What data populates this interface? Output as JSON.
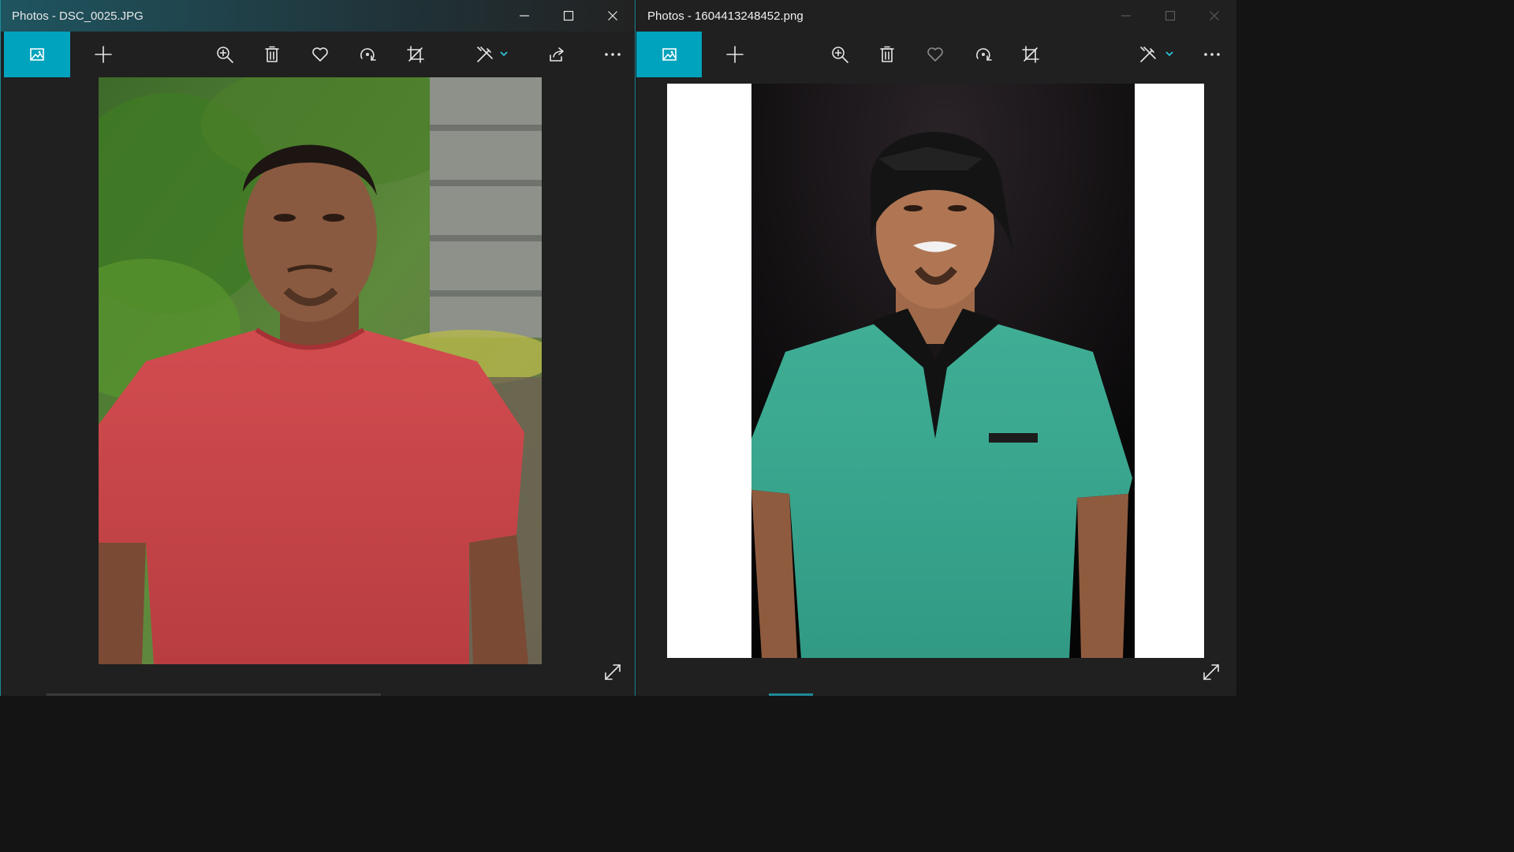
{
  "windows": [
    {
      "title": "Photos - DSC_0025.JPG",
      "toolbar": [
        "photo-view-icon",
        "add-icon",
        "zoom-in-icon",
        "delete-icon",
        "favorite-icon",
        "rotate-icon",
        "crop-icon",
        "edit-icon",
        "share-icon",
        "more-icon"
      ],
      "photo": {
        "subject": "photo",
        "shirt_color": "#c9474a",
        "background": "garden"
      }
    },
    {
      "title": "Photos - 1604413248452.png",
      "toolbar": [
        "photo-view-icon",
        "add-icon",
        "zoom-in-icon",
        "delete-icon",
        "favorite-icon",
        "rotate-icon",
        "crop-icon",
        "edit-icon",
        "more-icon"
      ],
      "photo": {
        "subject": "photo",
        "shirt_color": "#3aa58e",
        "background": "black"
      }
    }
  ],
  "colors": {
    "accent": "#00a3bd",
    "window_bg": "#202020",
    "title_text": "#e8e8e8"
  }
}
